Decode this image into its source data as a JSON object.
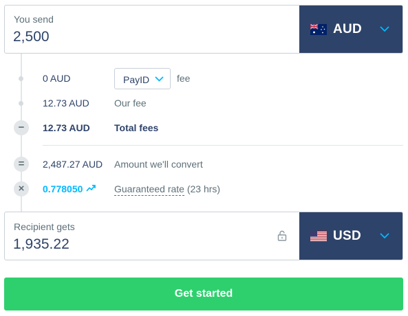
{
  "send": {
    "label": "You send",
    "amount": "2,500",
    "currency": "AUD"
  },
  "breakdown": {
    "payment_fee_amount": "0 AUD",
    "payment_method": "PayID",
    "payment_fee_suffix": "fee",
    "our_fee_amount": "12.73 AUD",
    "our_fee_label": "Our fee",
    "total_fees_amount": "12.73 AUD",
    "total_fees_label": "Total fees",
    "convert_amount": "2,487.27 AUD",
    "convert_label": "Amount we'll convert",
    "rate_value": "0.778050",
    "rate_label": "Guaranteed rate",
    "rate_duration": "(23 hrs)"
  },
  "receive": {
    "label": "Recipient gets",
    "amount": "1,935.22",
    "currency": "USD"
  },
  "cta": {
    "label": "Get started"
  },
  "operators": {
    "minus": "−",
    "equals": "=",
    "times": "×"
  },
  "colors": {
    "navy": "#2e4369",
    "accent_blue": "#00b9ff",
    "green": "#2ed06e",
    "muted": "#5d7079"
  },
  "icons": {
    "au_flag": "au-flag-icon",
    "us_flag": "us-flag-icon",
    "chevron": "chevron-down-icon",
    "lock": "lock-icon",
    "trend": "trending-up-icon"
  }
}
